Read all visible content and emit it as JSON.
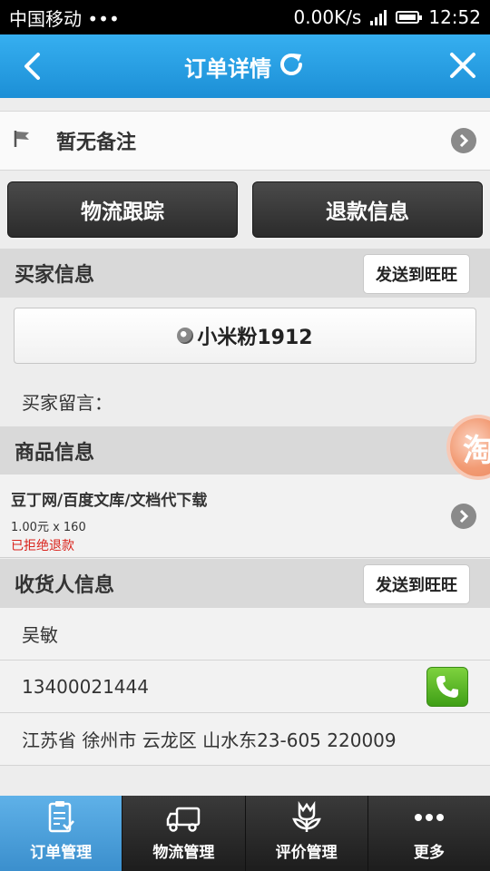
{
  "status_bar": {
    "carrier": "中国移动 •••",
    "speed": "0.00K/s",
    "signal_icon": "signal-icon",
    "battery_icon": "battery-icon",
    "time": "12:52"
  },
  "header": {
    "title": "订单详情",
    "back_icon": "back-arrow-icon",
    "refresh_icon": "refresh-icon",
    "close_icon": "close-icon"
  },
  "notes": {
    "text": "暂无备注",
    "flag_icon": "flag-icon"
  },
  "actions": {
    "logistics": "物流跟踪",
    "refund": "退款信息"
  },
  "buyer": {
    "section_title": "买家信息",
    "send_button": "发送到旺旺",
    "nickname": "小米粉1912",
    "message_label": "买家留言："
  },
  "goods": {
    "section_title": "商品信息",
    "name": "豆丁网/百度文库/文档代下载",
    "price_qty": "1.00元 x 160",
    "refund_status": "已拒绝退款"
  },
  "receiver": {
    "section_title": "收货人信息",
    "send_button": "发送到旺旺",
    "name": "吴敏",
    "phone": "13400021444",
    "address": "江苏省 徐州市 云龙区 山水东23-605 220009"
  },
  "float_badge": {
    "text": "淘"
  },
  "tabs": [
    {
      "label": "订单管理",
      "icon": "clipboard-icon",
      "active": true
    },
    {
      "label": "物流管理",
      "icon": "truck-icon",
      "active": false
    },
    {
      "label": "评价管理",
      "icon": "tulip-icon",
      "active": false
    },
    {
      "label": "更多",
      "icon": "more-dots-icon",
      "active": false
    }
  ],
  "colors": {
    "header": "#1c8fd6",
    "refund_text": "#d9231c",
    "active_tab": "#3b8fcd"
  }
}
